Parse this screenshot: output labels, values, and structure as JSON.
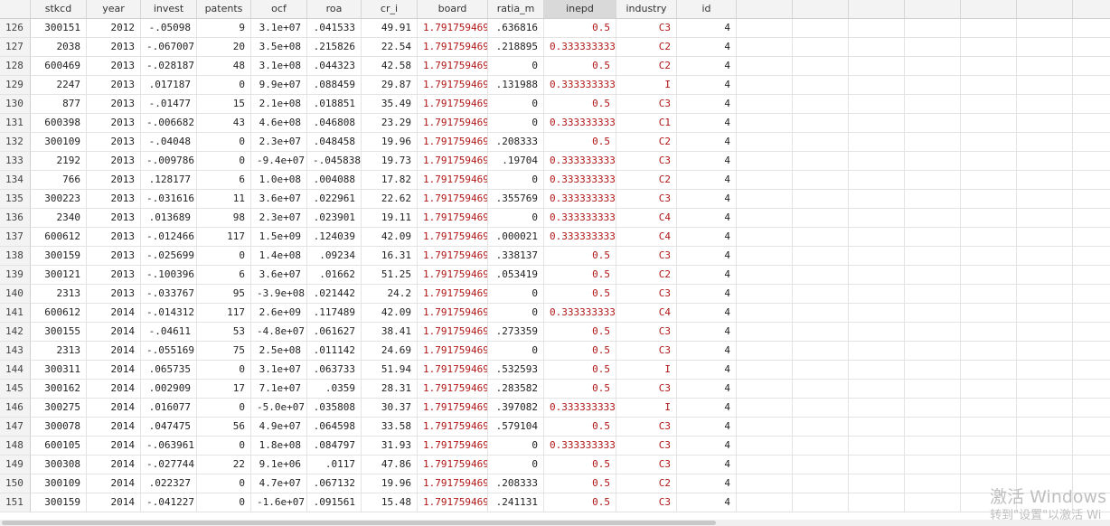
{
  "columns": [
    "stkcd",
    "year",
    "invest",
    "patents",
    "ocf",
    "roa",
    "cr_i",
    "board",
    "ratia_m",
    "inepd",
    "industry",
    "id"
  ],
  "selected_column": "inepd",
  "rows": [
    {
      "n": "126",
      "stkcd": "300151",
      "year": "2012",
      "invest": "-.05098",
      "patents": "9",
      "ocf": "3.1e+07",
      "roa": ".041533",
      "cr_i": "49.91",
      "board": "1.791759469",
      "ratia_m": ".636816",
      "inepd": "0.5",
      "industry": "C3",
      "id": "4"
    },
    {
      "n": "127",
      "stkcd": "2038",
      "year": "2013",
      "invest": "-.067007",
      "patents": "20",
      "ocf": "3.5e+08",
      "roa": ".215826",
      "cr_i": "22.54",
      "board": "1.791759469",
      "ratia_m": ".218895",
      "inepd": "0.333333333",
      "industry": "C2",
      "id": "4"
    },
    {
      "n": "128",
      "stkcd": "600469",
      "year": "2013",
      "invest": "-.028187",
      "patents": "48",
      "ocf": "3.1e+08",
      "roa": ".044323",
      "cr_i": "42.58",
      "board": "1.791759469",
      "ratia_m": "0",
      "inepd": "0.5",
      "industry": "C2",
      "id": "4"
    },
    {
      "n": "129",
      "stkcd": "2247",
      "year": "2013",
      "invest": ".017187",
      "patents": "0",
      "ocf": "9.9e+07",
      "roa": ".088459",
      "cr_i": "29.87",
      "board": "1.791759469",
      "ratia_m": ".131988",
      "inepd": "0.333333333",
      "industry": "I",
      "id": "4"
    },
    {
      "n": "130",
      "stkcd": "877",
      "year": "2013",
      "invest": "-.01477",
      "patents": "15",
      "ocf": "2.1e+08",
      "roa": ".018851",
      "cr_i": "35.49",
      "board": "1.791759469",
      "ratia_m": "0",
      "inepd": "0.5",
      "industry": "C3",
      "id": "4"
    },
    {
      "n": "131",
      "stkcd": "600398",
      "year": "2013",
      "invest": "-.006682",
      "patents": "43",
      "ocf": "4.6e+08",
      "roa": ".046808",
      "cr_i": "23.29",
      "board": "1.791759469",
      "ratia_m": "0",
      "inepd": "0.333333333",
      "industry": "C1",
      "id": "4"
    },
    {
      "n": "132",
      "stkcd": "300109",
      "year": "2013",
      "invest": "-.04048",
      "patents": "0",
      "ocf": "2.3e+07",
      "roa": ".048458",
      "cr_i": "19.96",
      "board": "1.791759469",
      "ratia_m": ".208333",
      "inepd": "0.5",
      "industry": "C2",
      "id": "4"
    },
    {
      "n": "133",
      "stkcd": "2192",
      "year": "2013",
      "invest": "-.009786",
      "patents": "0",
      "ocf": "-9.4e+07",
      "roa": "-.045838",
      "cr_i": "19.73",
      "board": "1.791759469",
      "ratia_m": ".19704",
      "inepd": "0.333333333",
      "industry": "C3",
      "id": "4"
    },
    {
      "n": "134",
      "stkcd": "766",
      "year": "2013",
      "invest": ".128177",
      "patents": "6",
      "ocf": "1.0e+08",
      "roa": ".004088",
      "cr_i": "17.82",
      "board": "1.791759469",
      "ratia_m": "0",
      "inepd": "0.333333333",
      "industry": "C2",
      "id": "4"
    },
    {
      "n": "135",
      "stkcd": "300223",
      "year": "2013",
      "invest": "-.031616",
      "patents": "11",
      "ocf": "3.6e+07",
      "roa": ".022961",
      "cr_i": "22.62",
      "board": "1.791759469",
      "ratia_m": ".355769",
      "inepd": "0.333333333",
      "industry": "C3",
      "id": "4"
    },
    {
      "n": "136",
      "stkcd": "2340",
      "year": "2013",
      "invest": ".013689",
      "patents": "98",
      "ocf": "2.3e+07",
      "roa": ".023901",
      "cr_i": "19.11",
      "board": "1.791759469",
      "ratia_m": "0",
      "inepd": "0.333333333",
      "industry": "C4",
      "id": "4"
    },
    {
      "n": "137",
      "stkcd": "600612",
      "year": "2013",
      "invest": "-.012466",
      "patents": "117",
      "ocf": "1.5e+09",
      "roa": ".124039",
      "cr_i": "42.09",
      "board": "1.791759469",
      "ratia_m": ".000021",
      "inepd": "0.333333333",
      "industry": "C4",
      "id": "4"
    },
    {
      "n": "138",
      "stkcd": "300159",
      "year": "2013",
      "invest": "-.025699",
      "patents": "0",
      "ocf": "1.4e+08",
      "roa": ".09234",
      "cr_i": "16.31",
      "board": "1.791759469",
      "ratia_m": ".338137",
      "inepd": "0.5",
      "industry": "C3",
      "id": "4"
    },
    {
      "n": "139",
      "stkcd": "300121",
      "year": "2013",
      "invest": "-.100396",
      "patents": "6",
      "ocf": "3.6e+07",
      "roa": ".01662",
      "cr_i": "51.25",
      "board": "1.791759469",
      "ratia_m": ".053419",
      "inepd": "0.5",
      "industry": "C2",
      "id": "4"
    },
    {
      "n": "140",
      "stkcd": "2313",
      "year": "2013",
      "invest": "-.033767",
      "patents": "95",
      "ocf": "-3.9e+08",
      "roa": ".021442",
      "cr_i": "24.2",
      "board": "1.791759469",
      "ratia_m": "0",
      "inepd": "0.5",
      "industry": "C3",
      "id": "4"
    },
    {
      "n": "141",
      "stkcd": "600612",
      "year": "2014",
      "invest": "-.014312",
      "patents": "117",
      "ocf": "2.6e+09",
      "roa": ".117489",
      "cr_i": "42.09",
      "board": "1.791759469",
      "ratia_m": "0",
      "inepd": "0.333333333",
      "industry": "C4",
      "id": "4"
    },
    {
      "n": "142",
      "stkcd": "300155",
      "year": "2014",
      "invest": "-.04611",
      "patents": "53",
      "ocf": "-4.8e+07",
      "roa": ".061627",
      "cr_i": "38.41",
      "board": "1.791759469",
      "ratia_m": ".273359",
      "inepd": "0.5",
      "industry": "C3",
      "id": "4"
    },
    {
      "n": "143",
      "stkcd": "2313",
      "year": "2014",
      "invest": "-.055169",
      "patents": "75",
      "ocf": "2.5e+08",
      "roa": ".011142",
      "cr_i": "24.69",
      "board": "1.791759469",
      "ratia_m": "0",
      "inepd": "0.5",
      "industry": "C3",
      "id": "4"
    },
    {
      "n": "144",
      "stkcd": "300311",
      "year": "2014",
      "invest": ".065735",
      "patents": "0",
      "ocf": "3.1e+07",
      "roa": ".063733",
      "cr_i": "51.94",
      "board": "1.791759469",
      "ratia_m": ".532593",
      "inepd": "0.5",
      "industry": "I",
      "id": "4"
    },
    {
      "n": "145",
      "stkcd": "300162",
      "year": "2014",
      "invest": ".002909",
      "patents": "17",
      "ocf": "7.1e+07",
      "roa": ".0359",
      "cr_i": "28.31",
      "board": "1.791759469",
      "ratia_m": ".283582",
      "inepd": "0.5",
      "industry": "C3",
      "id": "4"
    },
    {
      "n": "146",
      "stkcd": "300275",
      "year": "2014",
      "invest": ".016077",
      "patents": "0",
      "ocf": "-5.0e+07",
      "roa": ".035808",
      "cr_i": "30.37",
      "board": "1.791759469",
      "ratia_m": ".397082",
      "inepd": "0.333333333",
      "industry": "I",
      "id": "4"
    },
    {
      "n": "147",
      "stkcd": "300078",
      "year": "2014",
      "invest": ".047475",
      "patents": "56",
      "ocf": "4.9e+07",
      "roa": ".064598",
      "cr_i": "33.58",
      "board": "1.791759469",
      "ratia_m": ".579104",
      "inepd": "0.5",
      "industry": "C3",
      "id": "4"
    },
    {
      "n": "148",
      "stkcd": "600105",
      "year": "2014",
      "invest": "-.063961",
      "patents": "0",
      "ocf": "1.8e+08",
      "roa": ".084797",
      "cr_i": "31.93",
      "board": "1.791759469",
      "ratia_m": "0",
      "inepd": "0.333333333",
      "industry": "C3",
      "id": "4"
    },
    {
      "n": "149",
      "stkcd": "300308",
      "year": "2014",
      "invest": "-.027744",
      "patents": "22",
      "ocf": "9.1e+06",
      "roa": ".0117",
      "cr_i": "47.86",
      "board": "1.791759469",
      "ratia_m": "0",
      "inepd": "0.5",
      "industry": "C3",
      "id": "4"
    },
    {
      "n": "150",
      "stkcd": "300109",
      "year": "2014",
      "invest": ".022327",
      "patents": "0",
      "ocf": "4.7e+07",
      "roa": ".067132",
      "cr_i": "19.96",
      "board": "1.791759469",
      "ratia_m": ".208333",
      "inepd": "0.5",
      "industry": "C2",
      "id": "4"
    },
    {
      "n": "151",
      "stkcd": "300159",
      "year": "2014",
      "invest": "-.041227",
      "patents": "0",
      "ocf": "-1.6e+07",
      "roa": ".091561",
      "cr_i": "15.48",
      "board": "1.791759469",
      "ratia_m": ".241131",
      "inepd": "0.5",
      "industry": "C3",
      "id": "4"
    }
  ],
  "watermark": {
    "line1": "激活 Windows",
    "line2": "转到\"设置\"以激活 Wi"
  },
  "colors": {
    "string_value": "#b11616",
    "selected_header": "#d9d9d9"
  }
}
